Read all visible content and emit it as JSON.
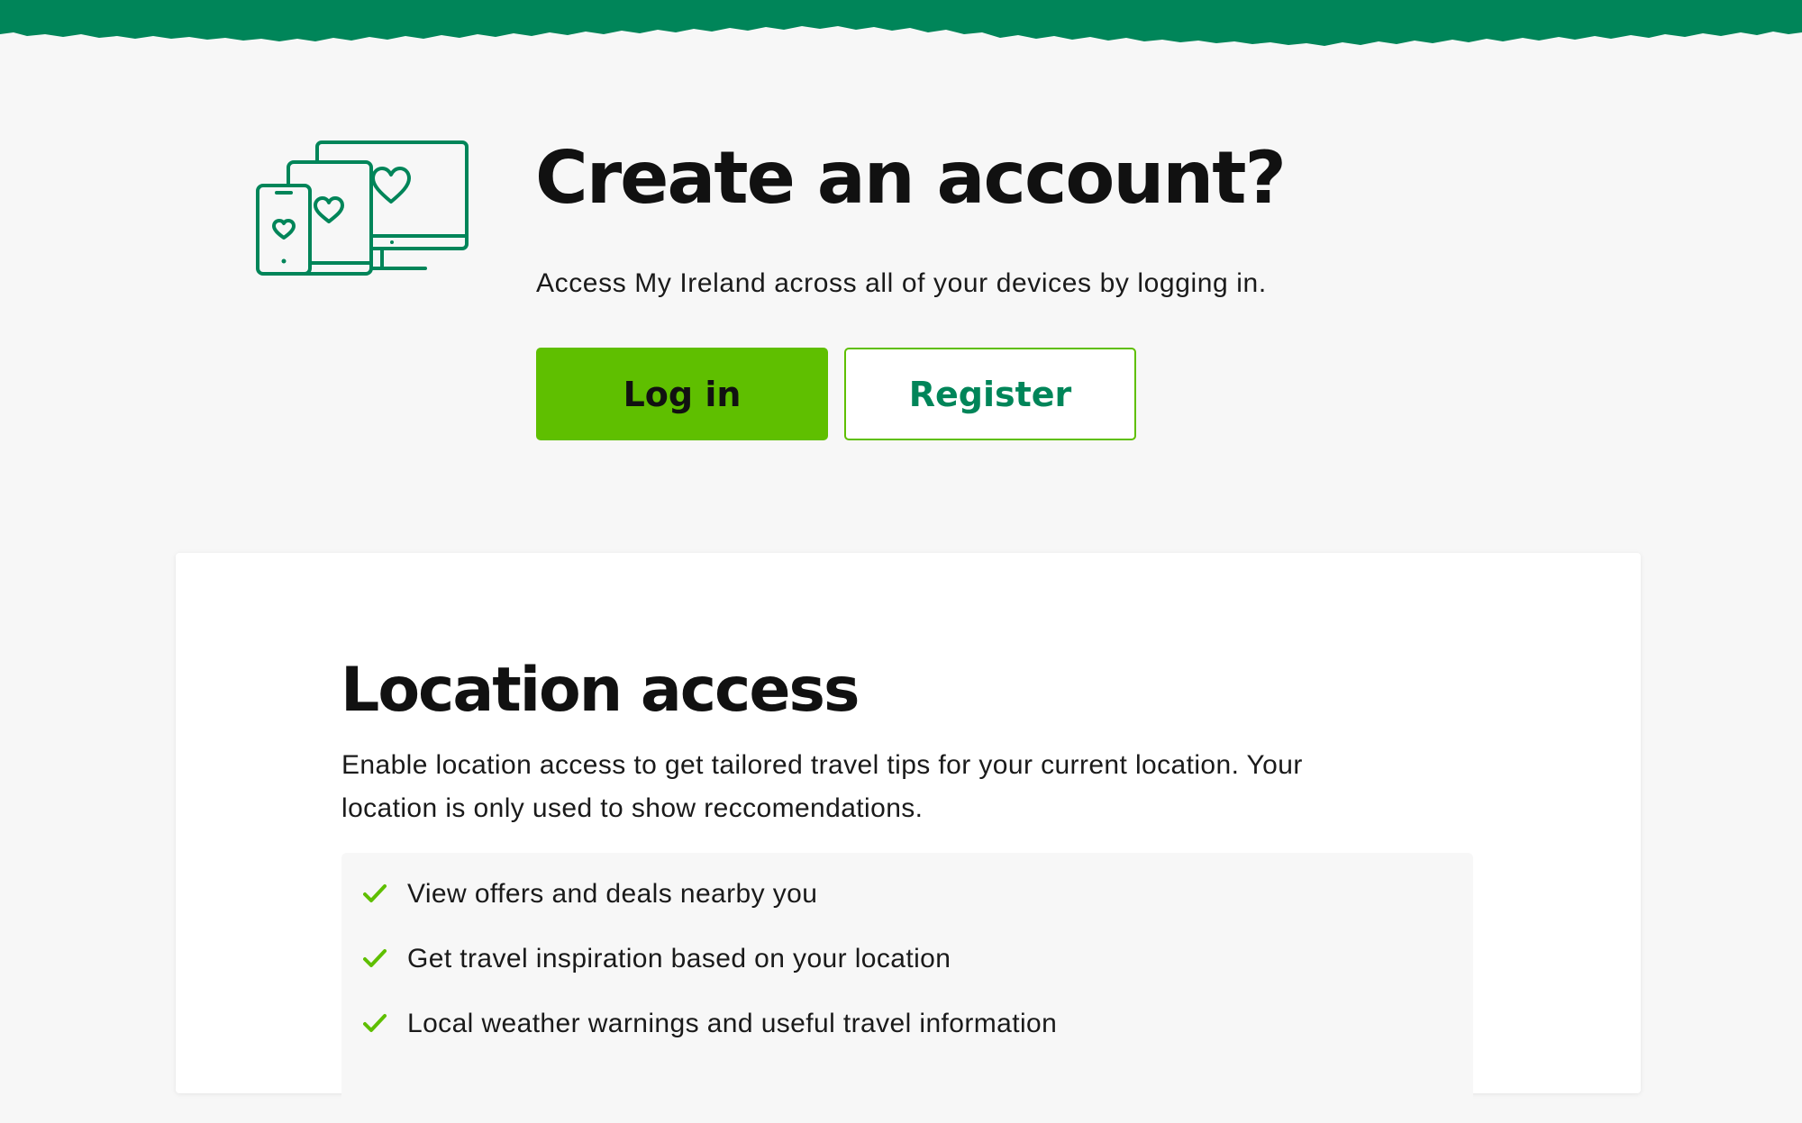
{
  "header": {
    "band_color": "#008559"
  },
  "account": {
    "illustration_icon": "devices-heart-icon",
    "title": "Create an account?",
    "subtitle": "Access My Ireland across all of your devices by logging in.",
    "login_label": "Log in",
    "register_label": "Register"
  },
  "location": {
    "title": "Location access",
    "description": "Enable location access to get tailored travel tips for your current location. Your location is only used to show reccomendations.",
    "benefits": [
      {
        "icon": "check-icon",
        "text": "View offers and deals nearby you"
      },
      {
        "icon": "check-icon",
        "text": "Get travel inspiration based on your location"
      },
      {
        "icon": "check-icon",
        "text": "Local weather warnings and useful travel information"
      }
    ]
  },
  "colors": {
    "brand_green": "#008559",
    "action_green": "#5fbf00",
    "check_green": "#5fbf00",
    "page_background": "#f7f7f7",
    "card_background": "#ffffff"
  }
}
